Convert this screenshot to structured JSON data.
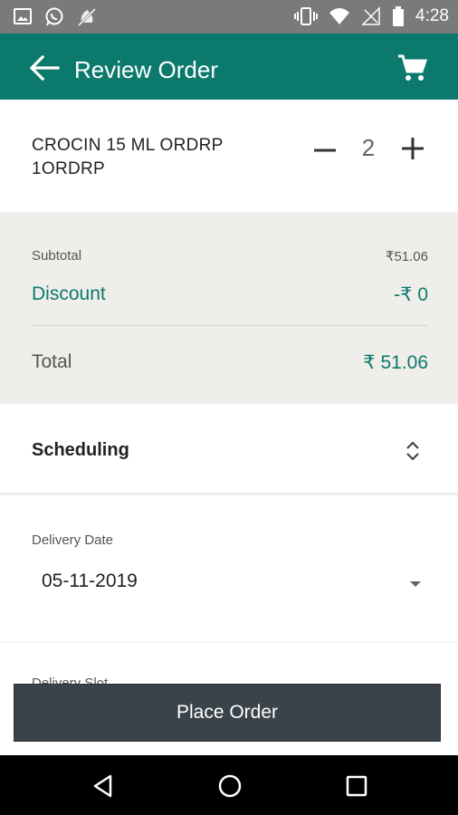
{
  "status_bar": {
    "time": "4:28",
    "icons": [
      "image-icon",
      "whatsapp-icon",
      "mute-icon",
      "vibrate-icon",
      "wifi-icon",
      "signal-icon",
      "battery-icon"
    ]
  },
  "app_bar": {
    "title": "Review Order",
    "icons": [
      "back-arrow-icon",
      "cart-icon"
    ]
  },
  "item": {
    "name": "CROCIN 15 ML ORDRP 1ORDRP",
    "quantity": "2"
  },
  "summary": {
    "subtotal_label": "Subtotal",
    "subtotal_value": "₹51.06",
    "discount_label": "Discount",
    "discount_value": "-₹ 0",
    "total_label": "Total",
    "total_value": "₹ 51.06"
  },
  "scheduling": {
    "label": "Scheduling"
  },
  "delivery": {
    "date_label": "Delivery Date",
    "date_value": "05-11-2019",
    "slot_label": "Delivery Slot"
  },
  "actions": {
    "place_order_label": "Place Order"
  },
  "colors": {
    "primary": "#0b7a6c",
    "button_dark": "#3a4349",
    "summary_bg": "#efeeea"
  }
}
